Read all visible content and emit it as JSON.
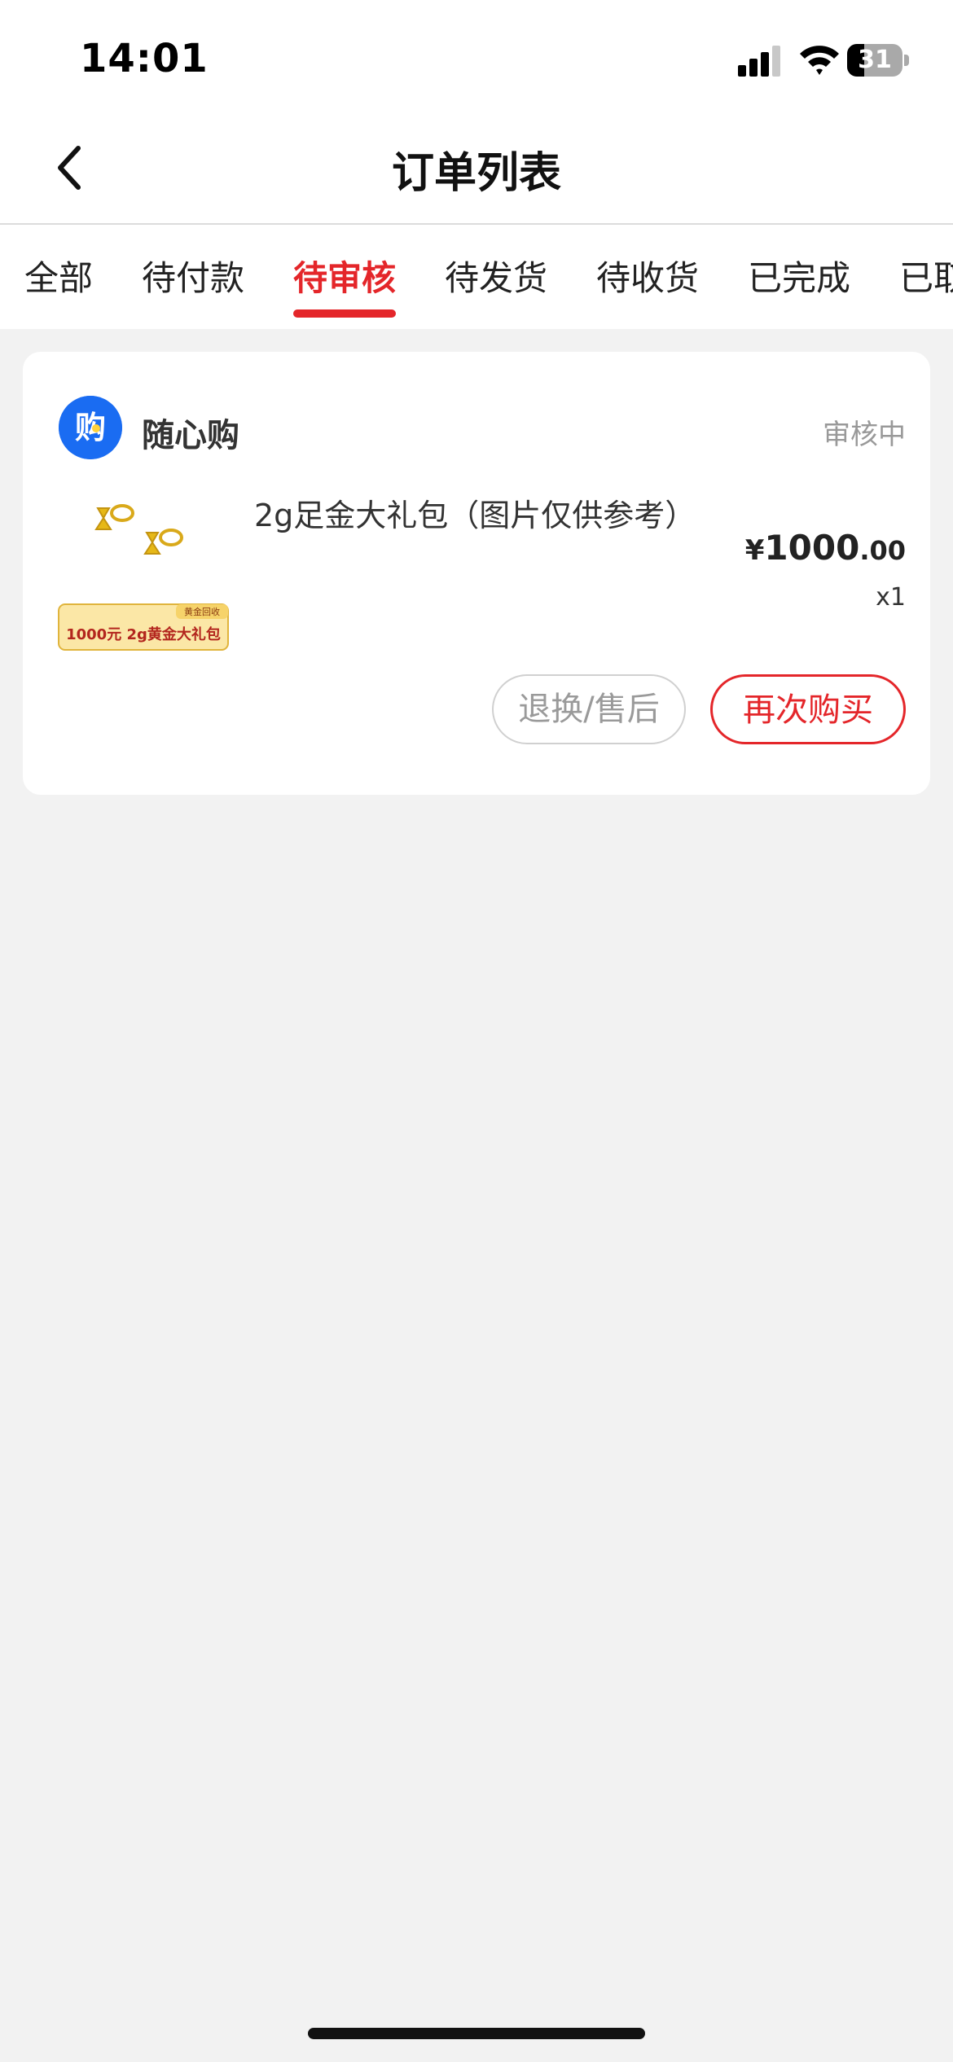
{
  "status_bar": {
    "time": "14:01",
    "battery_level": "31",
    "battery_fraction": 0.31
  },
  "header": {
    "title": "订单列表",
    "back_icon": "chevron-left-icon"
  },
  "tabs": [
    {
      "label": "全部",
      "active": false
    },
    {
      "label": "待付款",
      "active": false
    },
    {
      "label": "待审核",
      "active": true
    },
    {
      "label": "待发货",
      "active": false
    },
    {
      "label": "待收货",
      "active": false
    },
    {
      "label": "已完成",
      "active": false
    },
    {
      "label": "已取",
      "active": false
    }
  ],
  "order": {
    "shop_name": "随心购",
    "shop_logo_text": "购",
    "status": "审核中",
    "product_name": "2g足金大礼包（图片仅供参考）",
    "thumbnail": {
      "tag": "黄金回收",
      "caption": "1000元  2g黄金大礼包"
    },
    "price": {
      "currency": "¥",
      "integer": "1000",
      "decimal": ".00"
    },
    "quantity": "x1",
    "buttons": {
      "after_sale": "退换/售后",
      "rebuy": "再次购买"
    }
  },
  "colors": {
    "accent": "#e4262a",
    "logo_blue": "#1a6cf2",
    "background": "#f2f2f2"
  }
}
